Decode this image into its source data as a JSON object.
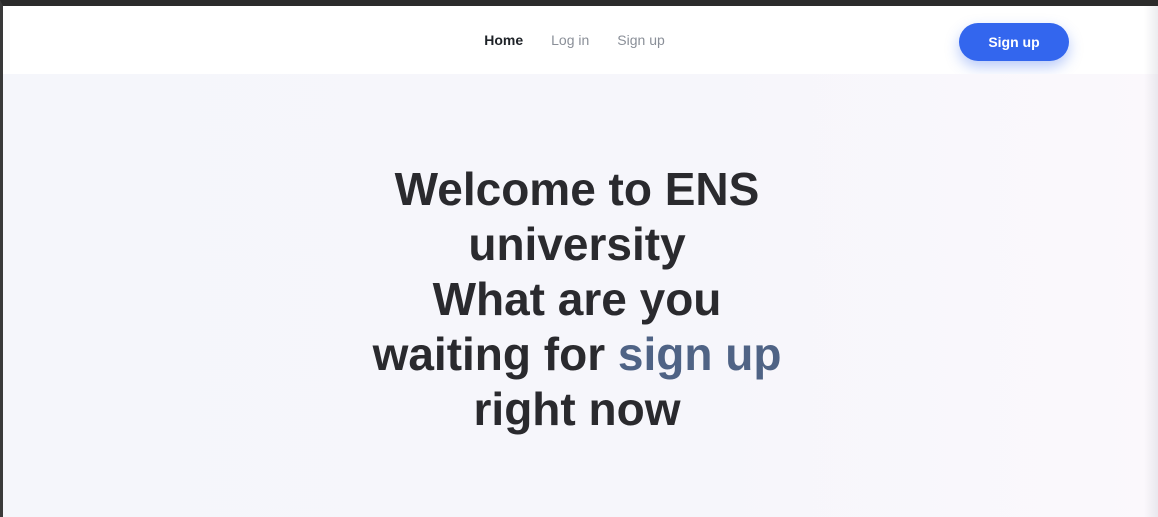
{
  "nav": {
    "links": [
      {
        "label": "Home",
        "active": true
      },
      {
        "label": "Log in",
        "active": false
      },
      {
        "label": "Sign up",
        "active": false
      }
    ],
    "cta_label": "Sign up"
  },
  "hero": {
    "line1": "Welcome to ENS",
    "line2": "university",
    "line3": "What are you",
    "line4_prefix": "waiting for ",
    "line4_highlight": "sign up",
    "line5": "right now"
  },
  "colors": {
    "primary_button": "#3366ee",
    "highlight_text": "#4f6385",
    "heading_text": "#2a2a2e",
    "hero_background": "#f5f6fb"
  }
}
